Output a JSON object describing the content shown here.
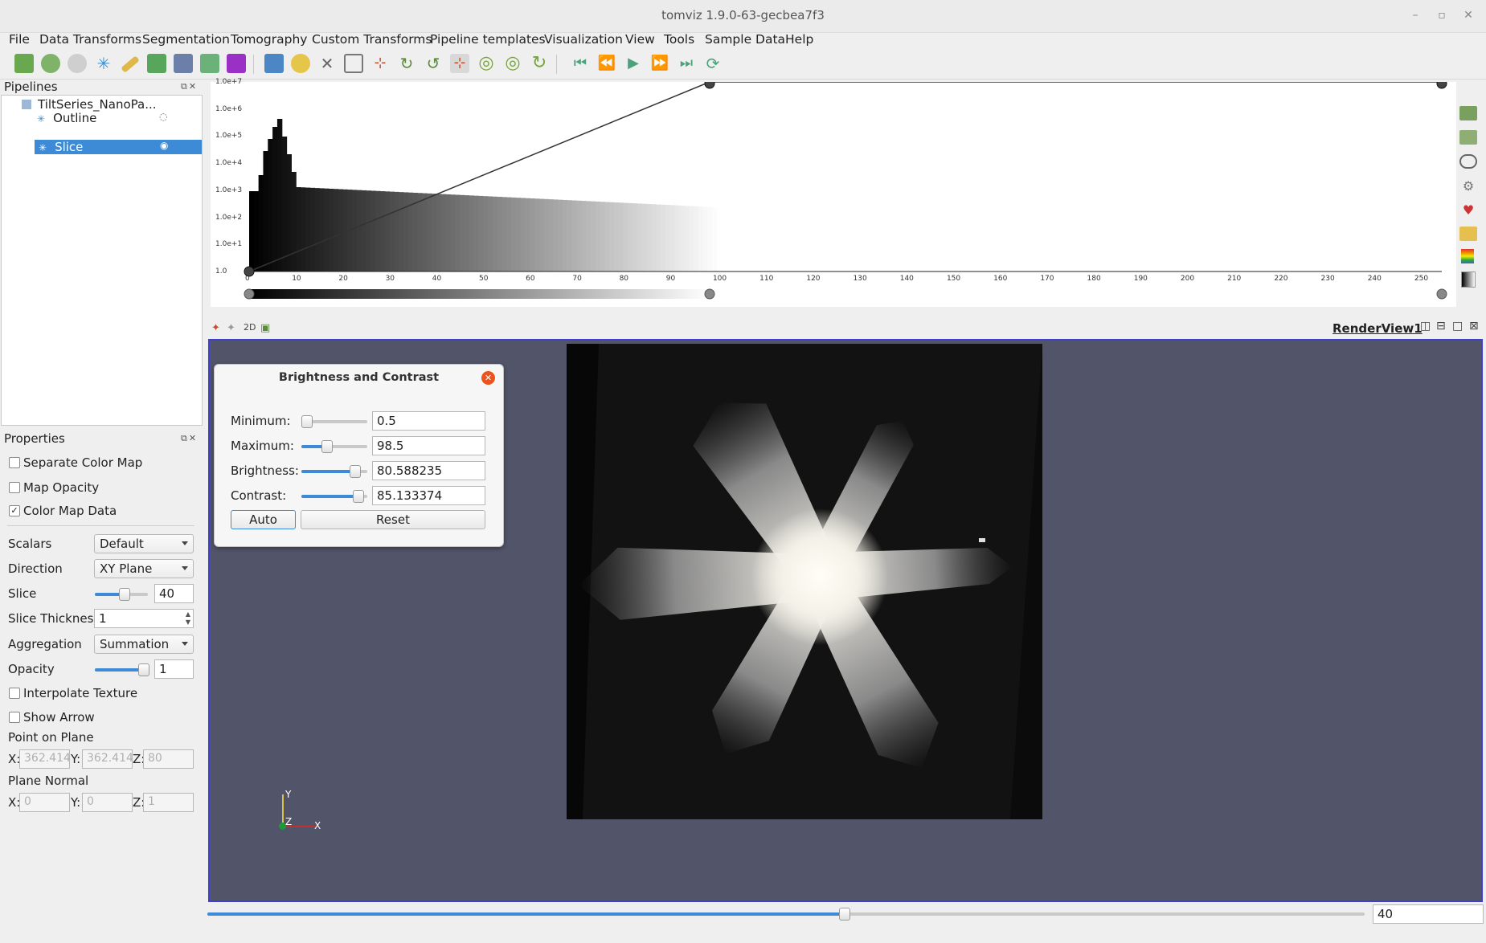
{
  "window": {
    "title": "tomviz 1.9.0-63-gecbea7f3"
  },
  "menu": [
    "File",
    "Data Transforms",
    "Segmentation",
    "Tomography",
    "Custom Transforms",
    "Pipeline templates",
    "Visualization",
    "View",
    "Tools",
    "Sample Data",
    "Help"
  ],
  "toolbar_icons": [
    "reconstruct-icon",
    "import-icon",
    "clip-icon",
    "snowflake-icon",
    "ruler-icon",
    "cube-add-icon",
    "cube-view-icon",
    "volume-icon",
    "purple-cube-icon",
    "pointer-icon",
    "palette-icon",
    "crop-icon",
    "zoom-to-box-icon",
    "axes-icon",
    "rotate-plus90-icon",
    "rotate-minus90-icon",
    "interact-icon",
    "reset-camera-icon",
    "refresh-icon",
    "refresh-alt-icon",
    "first-frame-icon",
    "prev-frame-icon",
    "play-icon",
    "next-frame-icon",
    "last-frame-icon",
    "loop-icon"
  ],
  "pipelines": {
    "title": "Pipelines",
    "items": [
      {
        "label": "TiltSeries_NanoPa..."
      },
      {
        "label": "Outline"
      },
      {
        "label": "Slice"
      }
    ]
  },
  "properties": {
    "title": "Properties",
    "separate_color_map": {
      "label": "Separate Color Map",
      "checked": false
    },
    "map_opacity": {
      "label": "Map Opacity",
      "checked": false
    },
    "color_map_data": {
      "label": "Color Map Data",
      "checked": true,
      "mark": "✓"
    },
    "scalars": {
      "label": "Scalars",
      "value": "Default"
    },
    "direction": {
      "label": "Direction",
      "value": "XY Plane"
    },
    "slice": {
      "label": "Slice",
      "value": "40",
      "level": 0.55
    },
    "slice_thickness": {
      "label": "Slice Thickness",
      "value": "1"
    },
    "aggregation": {
      "label": "Aggregation",
      "value": "Summation"
    },
    "opacity": {
      "label": "Opacity",
      "value": "1",
      "level": 1.0
    },
    "interpolate_texture": {
      "label": "Interpolate Texture",
      "checked": false
    },
    "show_arrow": {
      "label": "Show Arrow",
      "checked": false
    },
    "point_on_plane": {
      "label": "Point on Plane",
      "x_label": "X:",
      "y_label": "Y:",
      "z_label": "Z:",
      "x": "362.414",
      "y": "362.414",
      "z": "80"
    },
    "plane_normal": {
      "label": "Plane Normal",
      "x_label": "X:",
      "y_label": "Y:",
      "z_label": "Z:",
      "x": "0",
      "y": "0",
      "z": "1"
    }
  },
  "histogram": {
    "y_ticks": [
      "1.0e+7",
      "1.0e+6",
      "1.0e+5",
      "1.0e+4",
      "1.0e+3",
      "1.0e+2",
      "1.0e+1",
      "1.0"
    ],
    "x_ticks": [
      "0",
      "10",
      "20",
      "30",
      "40",
      "50",
      "60",
      "70",
      "80",
      "90",
      "100",
      "110",
      "120",
      "130",
      "140",
      "150",
      "160",
      "170",
      "180",
      "190",
      "200",
      "210",
      "220",
      "230",
      "240",
      "250"
    ],
    "colors": {
      "bars": "#111111",
      "line": "#333333"
    }
  },
  "render_view": {
    "title": "RenderView1",
    "mode_2d": "2D",
    "background": "#525569",
    "axes": {
      "y": "Y",
      "z": "Z",
      "x": "X"
    }
  },
  "brightness_contrast": {
    "title": "Brightness and Contrast",
    "minimum": {
      "label": "Minimum:",
      "value": "0.5",
      "level": 0.0
    },
    "maximum": {
      "label": "Maximum:",
      "value": "98.5",
      "level": 0.38
    },
    "brightness": {
      "label": "Brightness:",
      "value": "80.588235",
      "level": 0.8
    },
    "contrast": {
      "label": "Contrast:",
      "value": "85.133374",
      "level": 0.85
    },
    "auto_label": "Auto",
    "reset_label": "Reset"
  },
  "bottom": {
    "slice_value": "40",
    "level": 0.55
  }
}
